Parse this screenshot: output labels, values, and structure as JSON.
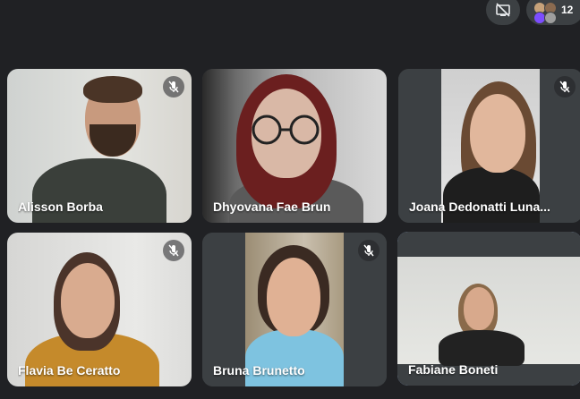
{
  "top_controls": {
    "present_icon": "screen-share-off-icon",
    "participant_count": "12"
  },
  "participants": [
    {
      "name": "Alisson Borba",
      "muted": true
    },
    {
      "name": "Dhyovana Fae Brun",
      "muted": false
    },
    {
      "name": "Joana Dedonatti Luna...",
      "muted": true
    },
    {
      "name": "Flavia Be Ceratto",
      "muted": true
    },
    {
      "name": "Bruna Brunetto",
      "muted": true
    },
    {
      "name": "Fabiane Boneti",
      "muted": false
    }
  ],
  "colors": {
    "background": "#202124",
    "tile": "#3c4043",
    "active_speaker_outline": "#a8c7fa"
  }
}
